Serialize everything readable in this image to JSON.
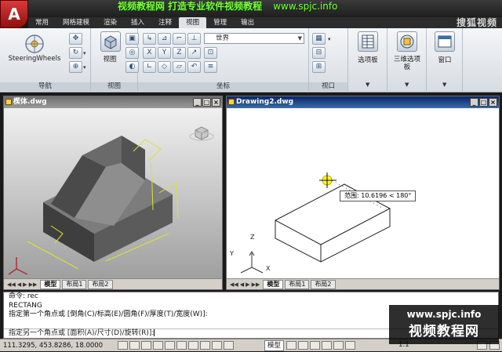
{
  "watermark": {
    "banner": "视频教程网 打造专业软件视频教程",
    "banner_url": "www.spjc.info",
    "logo": "搜狐视频",
    "bottom_url": "www.spjc.info",
    "bottom_text": "视频教程网"
  },
  "app": {
    "letter": "A"
  },
  "ribbon": {
    "tabs": [
      {
        "label": "常用",
        "active": false
      },
      {
        "label": "网格建模",
        "active": false
      },
      {
        "label": "渲染",
        "active": false
      },
      {
        "label": "插入",
        "active": false
      },
      {
        "label": "注释",
        "active": false
      },
      {
        "label": "视图",
        "active": true
      },
      {
        "label": "管理",
        "active": false
      },
      {
        "label": "输出",
        "active": false
      }
    ],
    "steering_label": "SteeringWheels",
    "view_button": "视图",
    "world_combo": "世界",
    "palettes_label": "选项板",
    "three_d_palettes_1": "三维选项",
    "three_d_palettes_2": "板",
    "window_label": "窗口",
    "panels": {
      "nav": "导航",
      "view": "视图",
      "ucs": "坐标",
      "viewport": "视口"
    }
  },
  "viewports": {
    "left": {
      "title": "楔体.dwg",
      "layout_tabs": [
        "模型",
        "布局1",
        "布局2"
      ]
    },
    "right": {
      "title": "Drawing2.dwg",
      "layout_tabs": [
        "模型",
        "布局1",
        "布局2"
      ],
      "tooltip_label": "范围:",
      "tooltip_value": "10.6196 < 180°",
      "ucs": {
        "x": "X",
        "y": "Y",
        "z": "Z"
      }
    }
  },
  "command": {
    "history": [
      "命令: rec",
      "RECTANG",
      "指定第一个角点或 [倒角(C)/标高(E)/圆角(F)/厚度(T)/宽度(W)]:",
      "指定另一个角点或 [面积(A)/尺寸(D)/旋转(R)]:"
    ]
  },
  "status": {
    "coords": "111.3295, 453.8286, 18.0000",
    "model_label": "模型",
    "scale": "1:1"
  }
}
